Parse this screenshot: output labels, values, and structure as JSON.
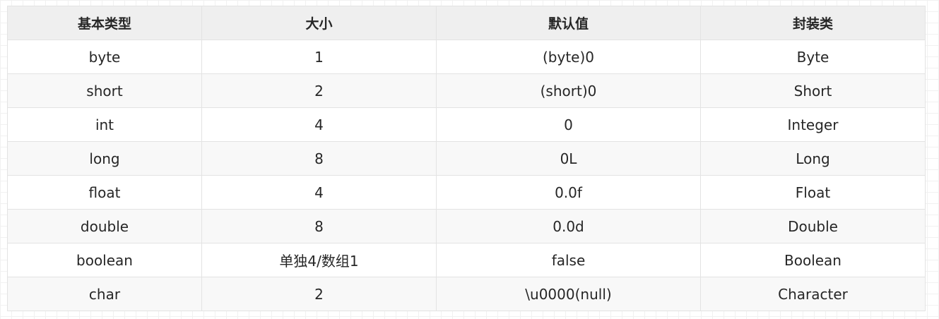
{
  "table": {
    "headers": [
      "基本类型",
      "大小",
      "默认值",
      "封装类"
    ],
    "rows": [
      [
        "byte",
        "1",
        "(byte)0",
        "Byte"
      ],
      [
        "short",
        "2",
        "(short)0",
        "Short"
      ],
      [
        "int",
        "4",
        "0",
        "Integer"
      ],
      [
        "long",
        "8",
        "0L",
        "Long"
      ],
      [
        "float",
        "4",
        "0.0f",
        "Float"
      ],
      [
        "double",
        "8",
        "0.0d",
        "Double"
      ],
      [
        "boolean",
        "单独4/数组1",
        "false",
        "Boolean"
      ],
      [
        "char",
        "2",
        "\\u0000(null)",
        "Character"
      ]
    ]
  }
}
